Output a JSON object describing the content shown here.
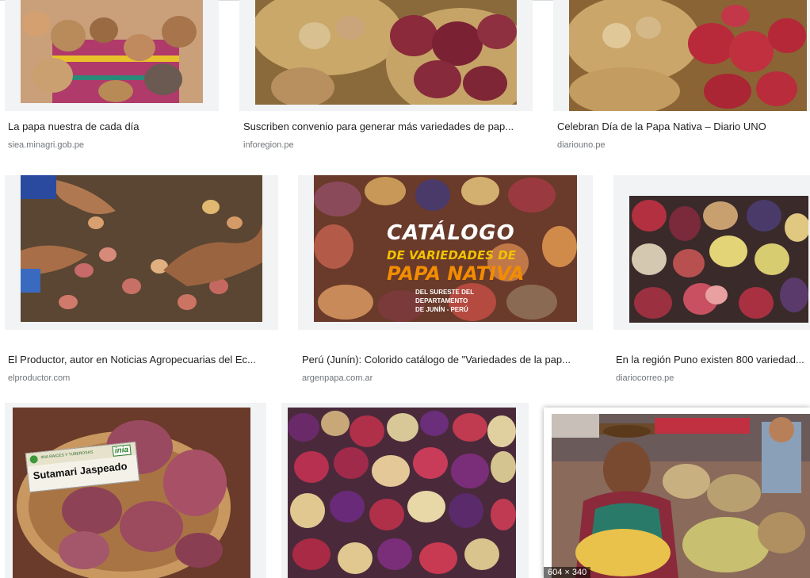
{
  "results": [
    {
      "title": "La papa nuestra de cada día",
      "source": "siea.minagri.gob.pe"
    },
    {
      "title": "Suscriben convenio para generar más variedades de pap...",
      "source": "inforegion.pe"
    },
    {
      "title": "Celebran Día de la Papa Nativa – Diario UNO",
      "source": "diariouno.pe"
    },
    {
      "title": "El Productor, autor en Noticias Agropecuarias del Ec...",
      "source": "elproductor.com"
    },
    {
      "title": "Perú (Junín): Colorido catálogo de \"Variedades de la pap...",
      "source": "argenpapa.com.ar"
    },
    {
      "title": "En la región Puno existen 800 variedad...",
      "source": "diariocorreo.pe"
    },
    {
      "title": "",
      "source": ""
    },
    {
      "title": "",
      "source": ""
    },
    {
      "title": "",
      "source": "",
      "badge": "604 × 340"
    }
  ],
  "catalog_overlay": {
    "line1": "CATÁLOGO",
    "line2": "DE VARIEDADES DE",
    "line3": "PAPA NATIVA",
    "line4": "DEL SURESTE DEL",
    "line5": "DEPARTAMENTO",
    "line6": "DE JUNÍN - PERÚ"
  },
  "label_sign": {
    "small": "INIA RAICES Y TUBEROSAS",
    "logo": "inia",
    "name": "Sutamari Jaspeado"
  },
  "colors": {
    "title": "#222222",
    "source": "#70757a",
    "tile_bg": "#f1f3f4",
    "catalog_yellow": "#f2c200",
    "catalog_orange": "#f28c00"
  }
}
